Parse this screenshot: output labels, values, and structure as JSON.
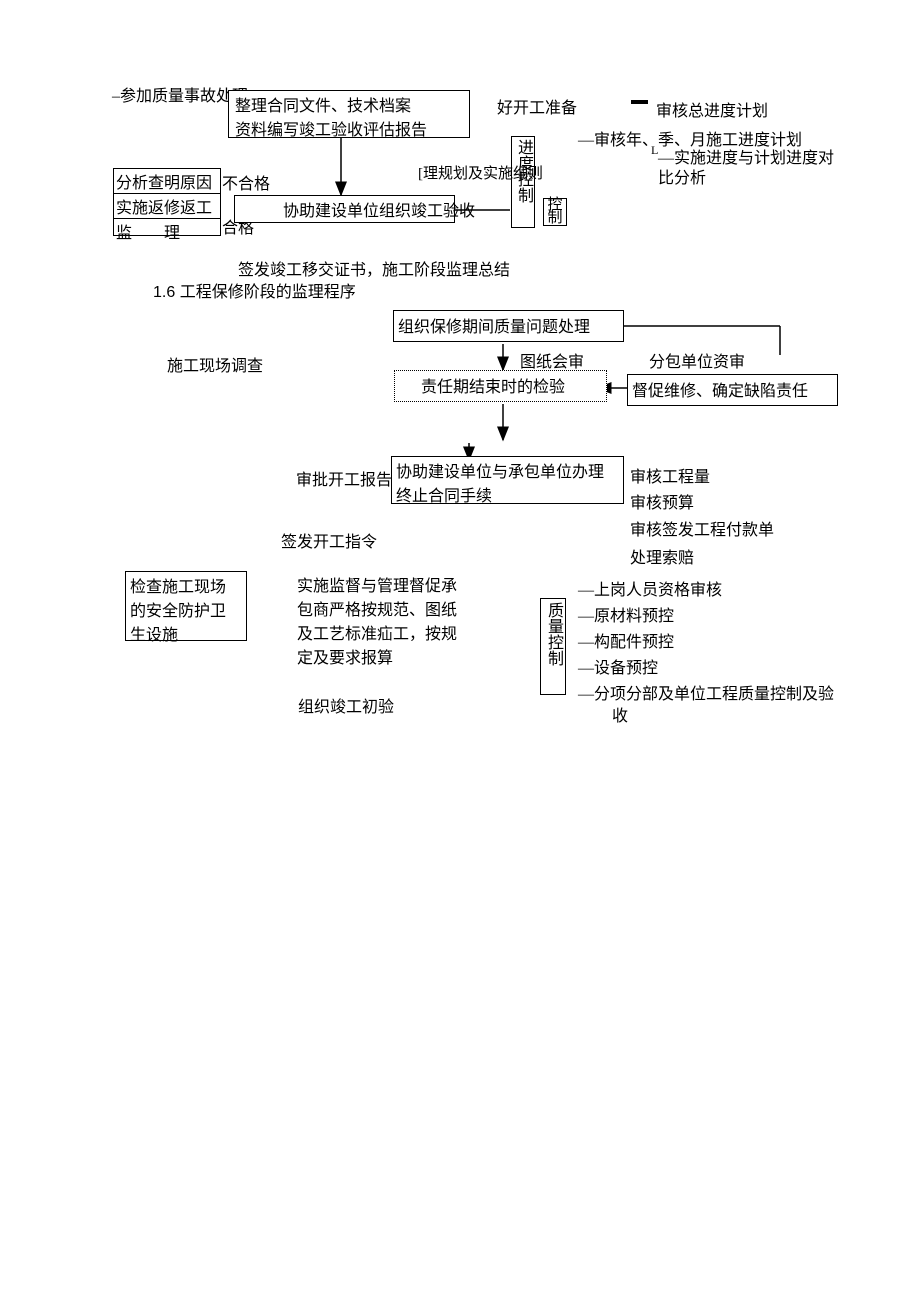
{
  "top": {
    "accident": "–参加质量事故处理",
    "archive1": "整理合同文件、技术档案",
    "archive2": "资料编写竣工验收评估报告",
    "prep": "好开工准备",
    "prog_col": "进度控制",
    "plan_rule": "[理规划及实施细则",
    "schedule_total": "审核总进度计划",
    "schedule_period": "—审核年、季、月施工进度计划",
    "schedule_compare": "—实施进度与计划进度对",
    "schedule_compare2": "比分析",
    "analyze": "分析查明原因",
    "unq": "不合格",
    "rework": "实施返修返工",
    "supervise": "监　　理",
    "qualified": "合格",
    "assist_accept": "协助建设单位组织竣工验收"
  },
  "mid_caption": "签发竣工移交证书，施工阶段监理总结",
  "heading": "1.6 工程保修阶段的监理程序",
  "flow": {
    "survey": "施工现场调查",
    "warranty_issue": "组织保修期间质量问题处理",
    "drawing_review": "图纸会审",
    "sub_review": "分包单位资审",
    "end_check": "责任期结束时的检验",
    "urge_repair": "督促维修、确定缺陷责任",
    "approve_start": "审批开工报告",
    "terminate1": "协助建设单位与承包单位办理",
    "terminate2": "终止合同手续",
    "issue_start": "签发开工指令"
  },
  "cost": {
    "qty": "审核工程量",
    "budget": "审核预算",
    "payment": "审核签发工程付款单",
    "claim": "处理索赔"
  },
  "safety": {
    "l1": "检查施工现场",
    "l2": "的安全防护卫",
    "l3": "生设施"
  },
  "impl": {
    "l1": "实施监督与管理督促承",
    "l2": "包商严格按规范、图纸",
    "l3": "及工艺标准疝工，按规",
    "l4": "定及要求报算",
    "prelim": "组织竣工初验"
  },
  "quality": {
    "col": "质量控制",
    "i1": "—上岗人员资格审核",
    "i2": "—原材料预控",
    "i3": "—构配件预控",
    "i4": "—设备预控",
    "i5": "—分项分部及单位工程质量控制及验",
    "i5b": "收"
  }
}
